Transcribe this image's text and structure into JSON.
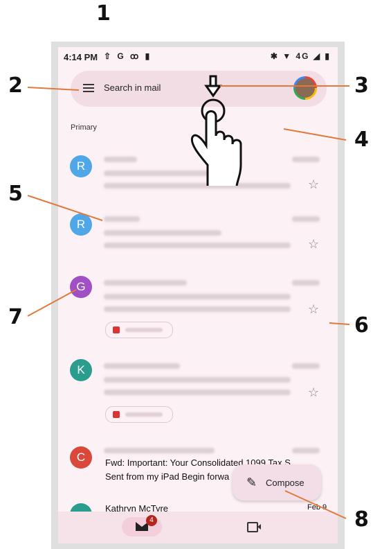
{
  "status_bar": {
    "time": "4:14 PM",
    "left_icons": [
      "upload-icon",
      "google-icon",
      "voicemail-icon",
      "clipboard-icon"
    ],
    "right_icons": [
      "bluetooth-icon",
      "wifi-icon",
      "network-4g",
      "signal-icon",
      "battery-icon"
    ],
    "network_label": "4G"
  },
  "search": {
    "placeholder": "Search in mail"
  },
  "section": {
    "label": "Primary"
  },
  "emails": [
    {
      "avatar_letter": "R",
      "avatar_color": "#4fa7e8"
    },
    {
      "avatar_letter": "R",
      "avatar_color": "#4fa7e8"
    },
    {
      "avatar_letter": "G",
      "avatar_color": "#a14fc4"
    },
    {
      "avatar_letter": "K",
      "avatar_color": "#2a9d8f"
    },
    {
      "avatar_letter": "C",
      "avatar_color": "#d9483b",
      "subject": "Fwd: Important: Your Consolidated 1099 Tax S",
      "preview": "Sent from my iPad Begin forwa"
    },
    {
      "sender": "Kathryn McTyre",
      "date": "Feb 9"
    }
  ],
  "compose": {
    "label": "Compose"
  },
  "bottom_nav": {
    "mail_badge": "4"
  },
  "callouts": [
    "1",
    "2",
    "3",
    "4",
    "5",
    "6",
    "7",
    "8"
  ],
  "colors": {
    "screen_bg": "#fcf1f4",
    "accent": "#e07a3c",
    "badge": "#b3261e"
  }
}
